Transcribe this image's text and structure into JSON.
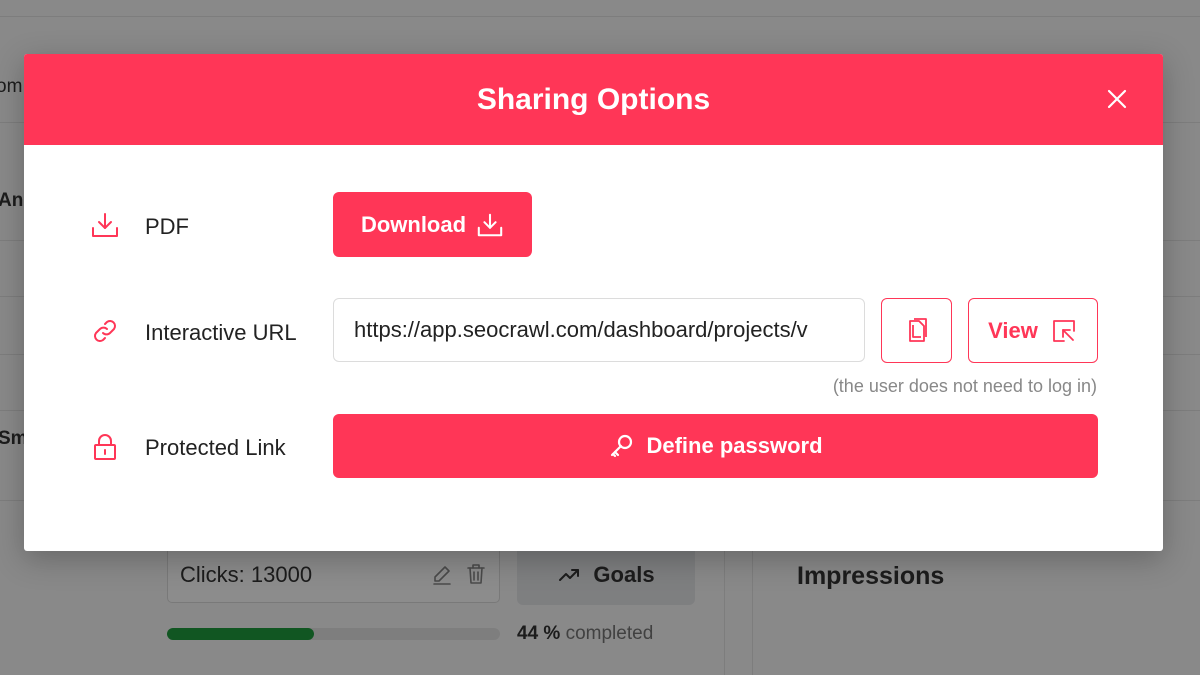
{
  "background": {
    "left_text_1": "om",
    "left_text_2": "An",
    "left_text_3": "Sm",
    "goal_card": {
      "clicks_label": "Clicks: 13000"
    },
    "goals_button_label": "Goals",
    "progress": {
      "percent": 44,
      "percent_label": "44 %",
      "suffix": "completed"
    },
    "impressions_title": "Impressions"
  },
  "modal": {
    "title": "Sharing Options",
    "rows": {
      "pdf": {
        "label": "PDF",
        "button_label": "Download"
      },
      "url": {
        "label": "Interactive URL",
        "value": "https://app.seocrawl.com/dashboard/projects/v",
        "view_label": "View",
        "hint": "(the user does not need to log in)"
      },
      "protected": {
        "label": "Protected Link",
        "button_label": "Define password"
      }
    }
  },
  "colors": {
    "accent": "#ff3657",
    "progress_fill": "#1f9d3e",
    "goals_button_bg": "#e6e7ea"
  },
  "icons": {
    "close": "close-icon",
    "pdf_row": "download-tray-icon",
    "download_button": "download-tray-icon",
    "url_row": "link-icon",
    "copy": "copy-icon",
    "view": "external-arrow-icon",
    "protected_row": "lock-icon",
    "password": "key-icon",
    "edit": "pencil-icon",
    "delete": "trash-icon",
    "goals": "trend-up-icon"
  }
}
